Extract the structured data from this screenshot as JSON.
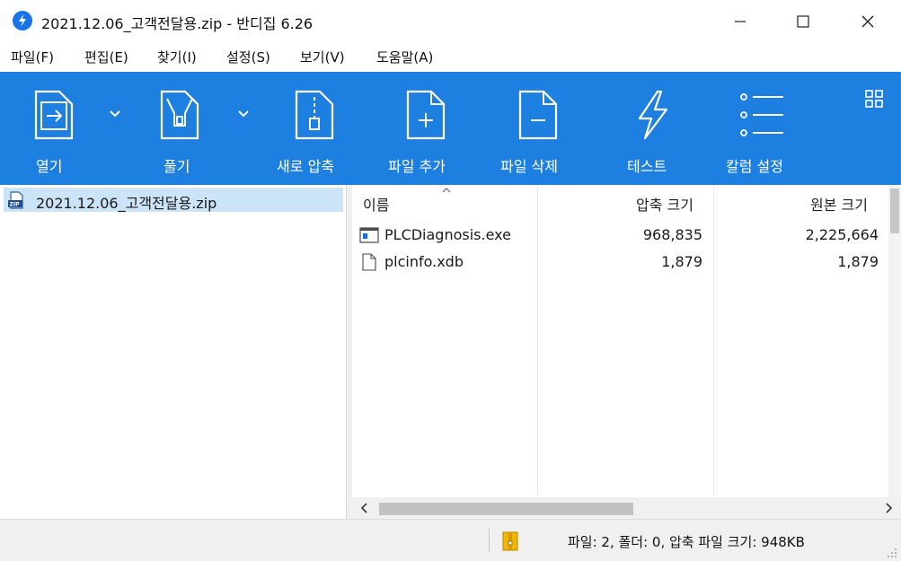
{
  "window": {
    "title": "2021.12.06_고객전달용.zip - 반디집 6.26"
  },
  "menu": {
    "items": [
      {
        "label": "파일(F)"
      },
      {
        "label": "편집(E)"
      },
      {
        "label": "찾기(I)"
      },
      {
        "label": "설정(S)"
      },
      {
        "label": "보기(V)"
      },
      {
        "label": "도움말(A)"
      }
    ]
  },
  "toolbar": {
    "items": [
      {
        "label": "열기",
        "icon": "open-icon"
      },
      {
        "label": "풀기",
        "icon": "extract-icon"
      },
      {
        "label": "새로 압축",
        "icon": "new-archive-icon"
      },
      {
        "label": "파일 추가",
        "icon": "add-file-icon"
      },
      {
        "label": "파일 삭제",
        "icon": "delete-file-icon"
      },
      {
        "label": "테스트",
        "icon": "test-icon"
      },
      {
        "label": "칼럼 설정",
        "icon": "column-settings-icon"
      }
    ],
    "color": "#1d7fe0"
  },
  "tree": {
    "items": [
      {
        "label": "2021.12.06_고객전달용.zip",
        "icon": "zip-icon"
      }
    ]
  },
  "list": {
    "columns": [
      {
        "label": "이름"
      },
      {
        "label": "압축 크기"
      },
      {
        "label": "원본 크기"
      }
    ],
    "rows": [
      {
        "name": "PLCDiagnosis.exe",
        "compressed": "968,835",
        "original": "2,225,664",
        "icon": "exe-icon"
      },
      {
        "name": "plcinfo.xdb",
        "compressed": "1,879",
        "original": "1,879",
        "icon": "document-icon"
      }
    ]
  },
  "status": {
    "text": "파일: 2, 폴더: 0, 압축 파일 크기: 948KB"
  }
}
